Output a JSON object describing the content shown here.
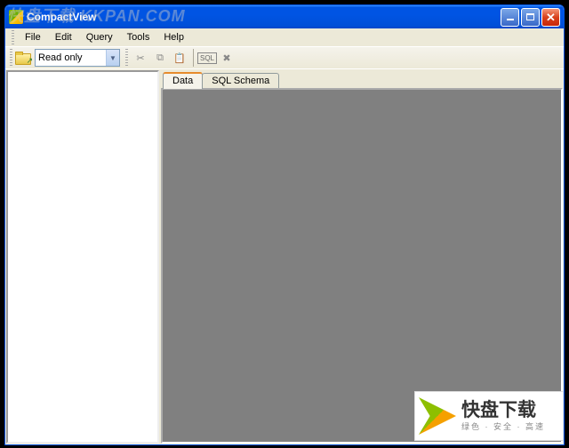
{
  "watermark": "快盘下载 KKPAN.COM",
  "window": {
    "title": "CompactView"
  },
  "menu": {
    "file": "File",
    "edit": "Edit",
    "query": "Query",
    "tools": "Tools",
    "help": "Help"
  },
  "toolbar": {
    "dropdown_value": "Read only",
    "sql_label": "SQL"
  },
  "tabs": {
    "data": "Data",
    "schema": "SQL Schema"
  },
  "badge": {
    "main": "快盘下载",
    "sub": "绿色 · 安全 · 高速"
  }
}
